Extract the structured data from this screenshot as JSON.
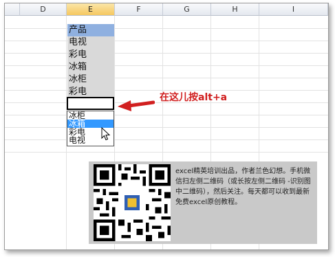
{
  "columns": [
    "D",
    "E",
    "F",
    "G",
    "H",
    "I"
  ],
  "selected_column": "E",
  "list": {
    "header": "产品",
    "items": [
      "电视",
      "彩电",
      "冰箱",
      "冰柜",
      "彩电"
    ]
  },
  "active_cell_value": "",
  "dropdown": {
    "items": [
      "冰柜",
      "冰箱",
      "彩电",
      "电视"
    ],
    "highlighted_index": 1
  },
  "annotation": "在这儿按alt+a",
  "annotation_color": "#d11f1f",
  "promo": {
    "text": "excel精英培训出品，作者兰色幻想。手机微信扫左侧二维码（或长按左侧二维码 -识别图中二维码），然后关注。每天都可以收到最新免费excel原创教程。"
  },
  "icons": [
    "mouse-pointer-icon",
    "red-arrow-icon",
    "qr-code-icon"
  ]
}
